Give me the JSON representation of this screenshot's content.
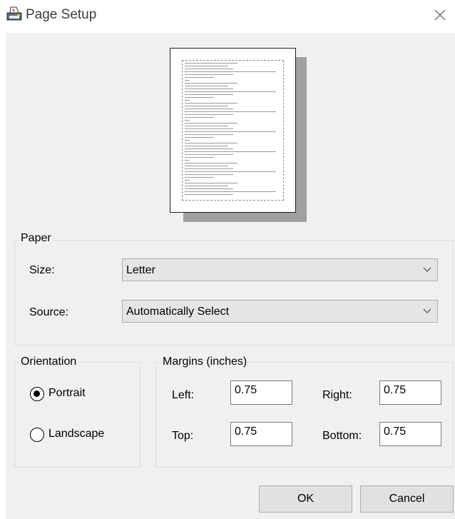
{
  "window": {
    "title": "Page Setup"
  },
  "icons": {
    "app": "printer-page-icon",
    "close": "close-icon",
    "dropdown": "chevron-down-icon"
  },
  "paper": {
    "legend": "Paper",
    "size_label": "Size:",
    "size_value": "Letter",
    "source_label": "Source:",
    "source_value": "Automatically Select"
  },
  "orientation": {
    "legend": "Orientation",
    "portrait_label": "Portrait",
    "landscape_label": "Landscape",
    "selected": "portrait"
  },
  "margins": {
    "legend": "Margins (inches)",
    "left_label": "Left:",
    "left_value": "0.75",
    "right_label": "Right:",
    "right_value": "0.75",
    "top_label": "Top:",
    "top_value": "0.75",
    "bottom_label": "Bottom:",
    "bottom_value": "0.75"
  },
  "buttons": {
    "ok": "OK",
    "cancel": "Cancel"
  }
}
